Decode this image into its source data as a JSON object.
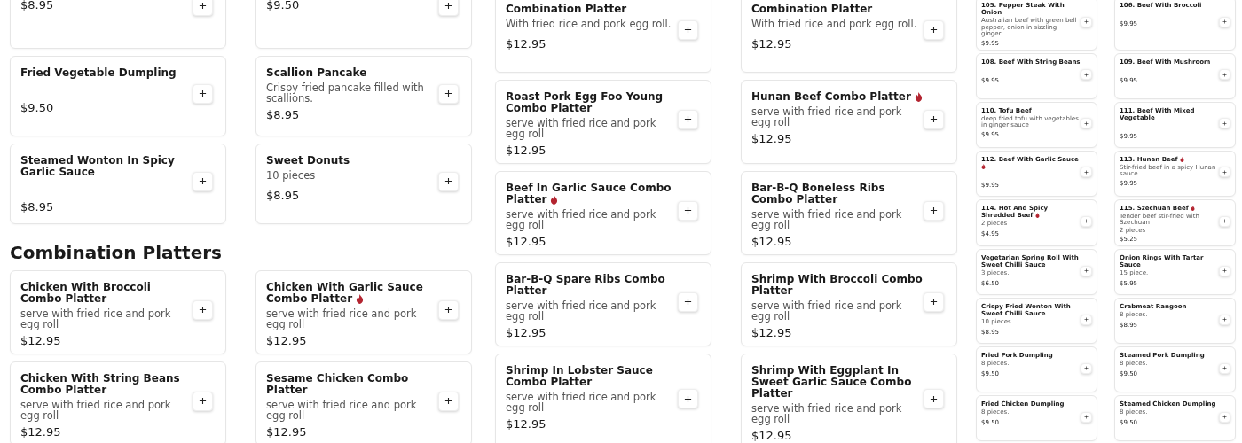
{
  "panels": [
    {
      "kind": "large",
      "sections": [
        {
          "items": [
            {
              "price": "$8.95"
            },
            {
              "price": "$9.50"
            },
            {
              "title": "Fried Vegetable Dumpling",
              "price": "$9.50"
            },
            {
              "title": "Scallion Pancake",
              "description": "Crispy fried pancake filled with scallions.",
              "price": "$8.95"
            },
            {
              "title": "Steamed Wonton In Spicy Garlic Sauce",
              "price": "$8.95"
            },
            {
              "title": "Sweet Donuts",
              "description": "10 pieces",
              "price": "$8.95"
            }
          ]
        },
        {
          "heading": "Combination Platters",
          "items": [
            {
              "title": "Chicken With Broccoli Combo Platter",
              "description": "serve with fried rice and pork egg roll",
              "price": "$12.95"
            },
            {
              "title": "Chicken With Garlic Sauce Combo Platter",
              "spicy": true,
              "description": "serve with fried rice and pork egg roll",
              "price": "$12.95"
            },
            {
              "title": "Chicken With String Beans Combo Platter",
              "description": "serve with fried rice and pork egg roll",
              "price": "$12.95"
            },
            {
              "title": "Sesame Chicken Combo Platter",
              "description": "serve with fried rice and pork egg roll",
              "price": "$12.95"
            }
          ]
        }
      ]
    },
    {
      "kind": "large",
      "sections": [
        {
          "items": [
            {
              "title": "Combination Platter",
              "description": "With fried rice and pork egg roll.",
              "price": "$12.95"
            },
            {
              "title": "Combination Platter",
              "description": "With fried rice and pork egg roll.",
              "price": "$12.95"
            },
            {
              "title": "Roast Pork Egg Foo Young Combo Platter",
              "description": "serve with fried rice and pork egg roll",
              "price": "$12.95"
            },
            {
              "title": "Hunan Beef Combo Platter",
              "spicy": true,
              "description": "serve with fried rice and pork egg roll",
              "price": "$12.95"
            },
            {
              "title": "Beef In Garlic Sauce Combo Platter",
              "spicy": true,
              "description": "serve with fried rice and pork egg roll",
              "price": "$12.95"
            },
            {
              "title": "Bar-B-Q Boneless Ribs Combo Platter",
              "description": "serve with fried rice and pork egg roll",
              "price": "$12.95"
            },
            {
              "title": "Bar-B-Q Spare Ribs Combo Platter",
              "description": "serve with fried rice and pork egg roll",
              "price": "$12.95"
            },
            {
              "title": "Shrimp With Broccoli Combo Platter",
              "description": "serve with fried rice and pork egg roll",
              "price": "$12.95"
            },
            {
              "title": "Shrimp In Lobster Sauce Combo Platter",
              "description": "serve with fried rice and pork egg roll",
              "price": "$12.95"
            },
            {
              "title": "Shrimp With Eggplant In Sweet Garlic Sauce Combo Platter",
              "description": "serve with fried rice and pork egg roll",
              "price": "$12.95"
            }
          ]
        }
      ]
    },
    {
      "kind": "small",
      "sections": [
        {
          "items": [
            {
              "title": "105. Pepper Steak With Onion",
              "description": "Australian beef with green bell pepper, onion in sizzling ginger...",
              "price": "$9.95"
            },
            {
              "title": "106. Beef With Broccoli",
              "price": "$9.95"
            },
            {
              "title": "108. Beef With String Beans",
              "price": "$9.95"
            },
            {
              "title": "109. Beef With Mushroom",
              "price": "$9.95"
            },
            {
              "title": "110. Tofu Beef",
              "description": "deep fried tofu with vegetables in ginger sauce",
              "price": "$9.95"
            },
            {
              "title": "111. Beef With Mixed Vegetable",
              "price": "$9.95"
            },
            {
              "title": "112. Beef With Garlic Sauce",
              "spicy": true,
              "price": "$9.95"
            },
            {
              "title": "113. Hunan Beef",
              "spicy": true,
              "description": "Stir-fried beef in a spicy Hunan sauce.",
              "price": "$9.95"
            },
            {
              "title": "114. Hot And Spicy Shredded Beef",
              "spicy": true,
              "portion": "2 pieces",
              "price": "$4.95"
            },
            {
              "title": "115. Szechuan Beef",
              "spicy": true,
              "description": "Tender beef stir-fried with Szechuan",
              "portion": "2 pieces",
              "price": "$5.25"
            },
            {
              "title": "Vegetarian Spring Roll With Sweet Chilli Sauce",
              "portion": "3 pieces.",
              "price": "$6.50"
            },
            {
              "title": "Onion Rings With Tartar Sauce",
              "portion": "15 piece.",
              "price": "$5.95"
            },
            {
              "title": "Crispy Fried Wonton With Sweet Chilli Sauce",
              "portion": "10 pieces.",
              "price": "$8.95"
            },
            {
              "title": "Crabmeat Rangoon",
              "portion": "8 pieces.",
              "price": "$8.95"
            },
            {
              "title": "Fried Pork Dumpling",
              "portion": "8 pieces.",
              "price": "$9.50"
            },
            {
              "title": "Steamed Pork Dumpling",
              "portion": "8 pieces.",
              "price": "$9.50"
            },
            {
              "title": "Fried Chicken Dumpling",
              "portion": "8 pieces.",
              "price": "$9.50"
            },
            {
              "title": "Steamed Chicken Dumpling",
              "portion": "8 pieces.",
              "price": "$9.50"
            }
          ]
        }
      ]
    }
  ]
}
